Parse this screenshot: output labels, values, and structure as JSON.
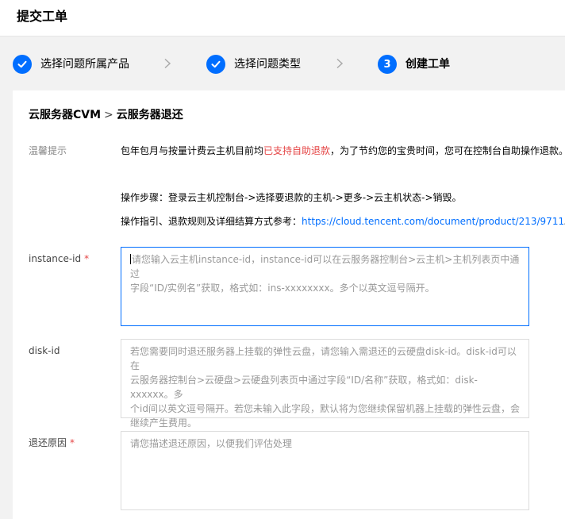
{
  "header": {
    "title": "提交工单"
  },
  "steps": [
    {
      "label": "选择问题所属产品",
      "status": "done"
    },
    {
      "label": "选择问题类型",
      "status": "done"
    },
    {
      "number": "3",
      "label": "创建工单",
      "status": "active"
    }
  ],
  "breadcrumb": {
    "product": "云服务器CVM",
    "separator": ">",
    "issue": "云服务器退还"
  },
  "notice": {
    "label": "温馨提示",
    "line1_before": "包年包月与按量计费云主机目前均",
    "line1_highlight": "已支持自助退款",
    "line1_after": "，为了节约您的宝贵时间，您可在控制台自助操作退款。",
    "line2": "操作步骤：登录云主机控制台->选择要退款的主机->更多->云主机状态->销毁。",
    "line3_prefix": "操作指引、退款规则及详细结算方式参考：",
    "line3_link": "https://cloud.tencent.com/document/product/213/9711",
    "line3_suffix": "。"
  },
  "form": {
    "instance_id": {
      "label": "instance-id",
      "required_mark": "*",
      "placeholder_line1": "请您输入云主机instance-id，instance-id可以在云服务器控制台>云主机>主机列表页中通过",
      "placeholder_line2": "字段“ID/实例名”获取，格式如：ins-xxxxxxxx。多个以英文逗号隔开。"
    },
    "disk_id": {
      "label": "disk-id",
      "placeholder_line1": "若您需要同时退还服务器上挂载的弹性云盘，请您输入需退还的云硬盘disk-id。disk-id可以在",
      "placeholder_line2": "云服务器控制台>云硬盘>云硬盘列表页中通过字段“ID/名称”获取，格式如：disk-xxxxxx。多",
      "placeholder_line3": "个id间以英文逗号隔开。若您未输入此字段，默认将为您继续保留机器上挂载的弹性云盘，会",
      "placeholder_line4": "继续产生费用。"
    },
    "reason": {
      "label": "退还原因",
      "required_mark": "*",
      "placeholder": "请您描述退还原因，以便我们评估处理"
    }
  },
  "colors": {
    "accent": "#006eff",
    "required": "#e54545",
    "highlight": "#e54545"
  },
  "icons": {
    "done_step": "check-icon",
    "step_separator": "chevron-right-icon"
  }
}
